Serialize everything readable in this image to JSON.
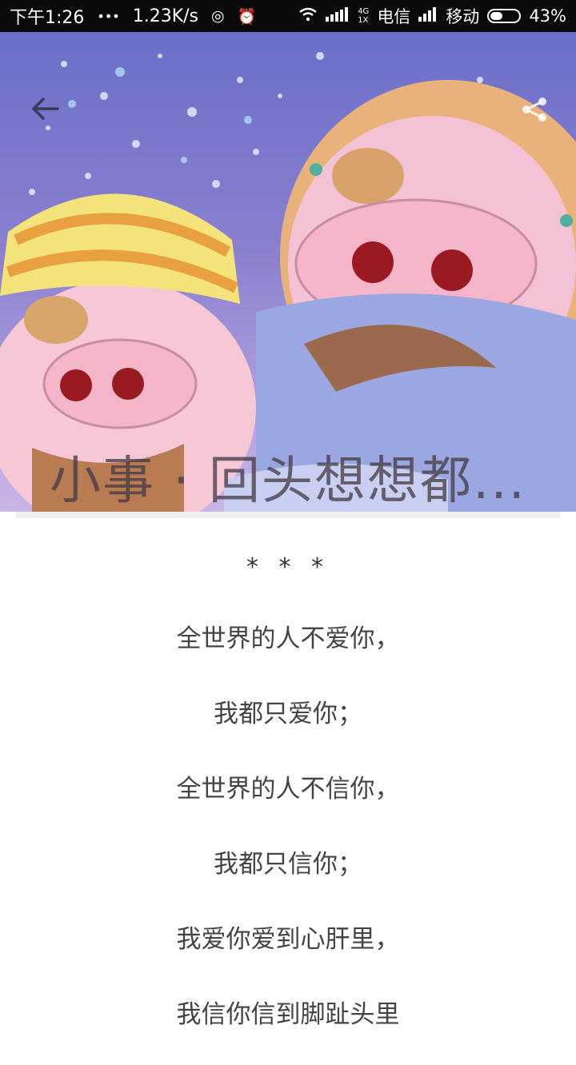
{
  "status_bar": {
    "time": "下午1:26",
    "dots": "•••",
    "speed": "1.23K/s",
    "net_top": "4G",
    "net_bottom": "1X",
    "carrier1": "电信",
    "carrier2": "移动",
    "battery": "43%",
    "battery_level": 0.43
  },
  "header": {
    "title": "小事 · 回头想想都...",
    "back_icon": "arrow-left-icon",
    "share_icon": "share-icon"
  },
  "article": {
    "stars": "* * *",
    "lines": [
      "全世界的人不爱你，",
      "我都只爱你；",
      "全世界的人不信你，",
      "我都只信你；",
      "我爱你爱到心肝里，",
      "我信你信到脚趾头里"
    ]
  }
}
